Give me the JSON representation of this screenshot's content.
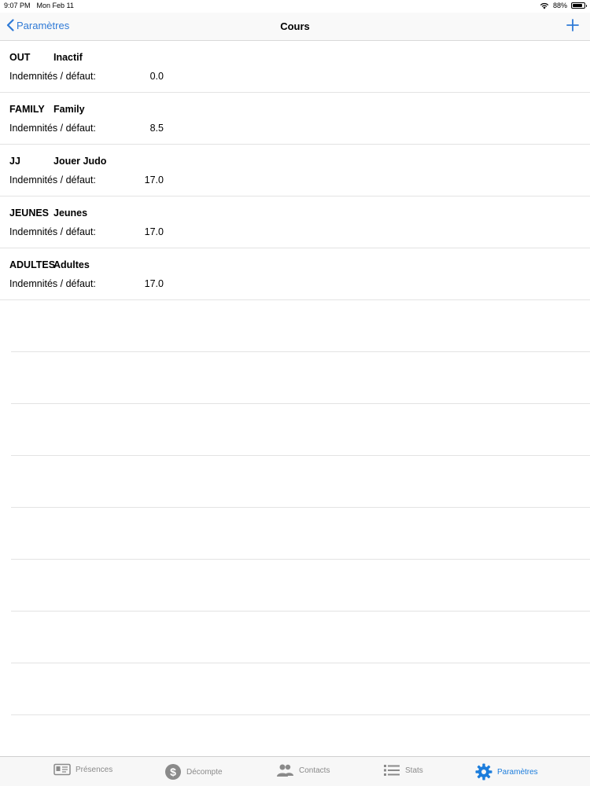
{
  "status_bar": {
    "time": "9:07 PM",
    "date": "Mon Feb 11",
    "battery": "88%",
    "battery_level": 0.88
  },
  "nav": {
    "back_label": "Paramètres",
    "title": "Cours",
    "add_icon": "plus-icon",
    "back_icon": "chevron-left-icon"
  },
  "courses": [
    {
      "code": "OUT",
      "name": "Inactif",
      "label": "Indemnités / défaut:",
      "value": "0.0"
    },
    {
      "code": "FAMILY",
      "name": "Family",
      "label": "Indemnités / défaut:",
      "value": "8.5"
    },
    {
      "code": "JJ",
      "name": "Jouer Judo",
      "label": "Indemnités / défaut:",
      "value": "17.0"
    },
    {
      "code": "JEUNES",
      "name": "Jeunes",
      "label": "Indemnités / défaut:",
      "value": "17.0"
    },
    {
      "code": "ADULTES",
      "name": "Adultes",
      "label": "Indemnités / défaut:",
      "value": "17.0"
    }
  ],
  "tabs": [
    {
      "label": "Présences",
      "icon": "id-card-icon"
    },
    {
      "label": "Décompte",
      "icon": "dollar-icon"
    },
    {
      "label": "Contacts",
      "icon": "people-icon"
    },
    {
      "label": "Stats",
      "icon": "list-icon"
    },
    {
      "label": "Paramètres",
      "icon": "gear-icon"
    }
  ],
  "colors": {
    "accent": "#1c7ddc",
    "inactive_tab": "#8a8a8a"
  }
}
